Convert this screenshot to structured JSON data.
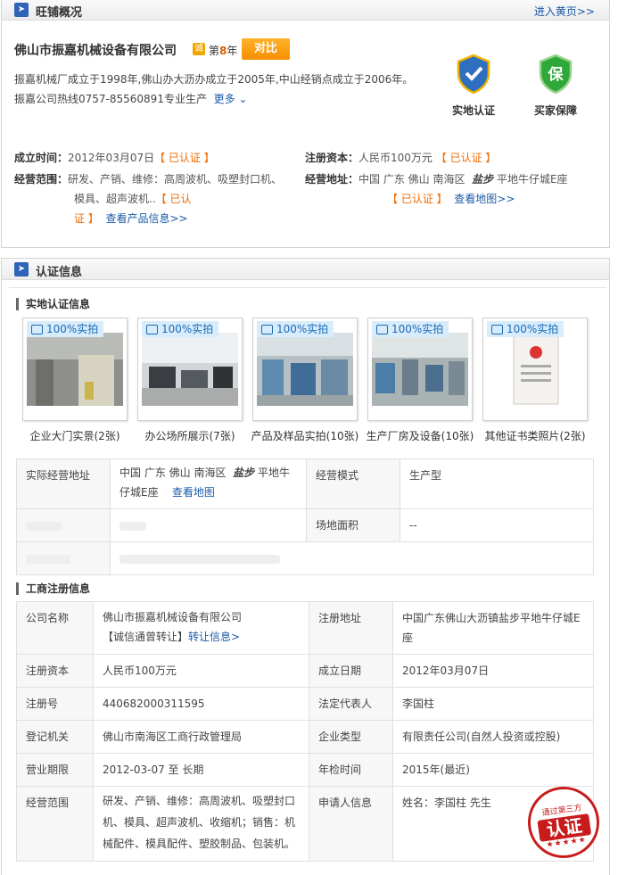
{
  "overview": {
    "title": "旺铺概况",
    "enter_shop_link": "进入黄页>>",
    "company_name": "佛山市振嘉机械设备有限公司",
    "cheng_badge": "诚",
    "years_prefix": "第",
    "years": "8",
    "years_suffix": "年",
    "compare_button": "对比",
    "intro_line1": "振嘉机械厂成立于1998年,佛山办大沥办成立于2005年,中山经销点成立于2006年。",
    "intro_line2": "振嘉公司热线0757-85560891专业生产",
    "more_link": "更多",
    "badge_onsite": "实地认证",
    "badge_buyer": "买家保障",
    "founded_label": "成立时间：",
    "founded_value": "2012年03月07日",
    "verified": "【 已认证 】",
    "capital_label": "注册资本：",
    "capital_value": "人民币100万元",
    "scope_label": "经营范围：",
    "scope_line1": "研发、产销、维修：高周波机、吸塑封口机、",
    "scope_line2": "模具、超声波机..",
    "scope_verified_a": "【 已认",
    "scope_verified_b": "证 】",
    "view_products_link": "查看产品信息>>",
    "address_label": "经营地址：",
    "address_value_a": "中国  广东  佛山  南海区",
    "address_value_b": "盐步",
    "address_value_c": "平地牛仔城E座",
    "address_verified": "【 已认证 】",
    "view_map_link": "查看地图>>"
  },
  "cert": {
    "title": "认证信息",
    "onsite_section": "实地认证信息",
    "photo_tag": "100%实拍",
    "photos": [
      {
        "caption": "企业大门实景(2张)"
      },
      {
        "caption": "办公场所展示(7张)"
      },
      {
        "caption": "产品及样品实拍(10张)"
      },
      {
        "caption": "生产厂房及设备(10张)"
      },
      {
        "caption": "其他证书类照片(2张)"
      }
    ],
    "site_table": {
      "addr_label": "实际经营地址",
      "addr_value_a": "中国  广东  佛山  南海区",
      "addr_value_b": "盐步",
      "addr_value_c": "平地牛",
      "addr_value_d": "仔城E座",
      "view_map": "查看地图",
      "mode_label": "经营模式",
      "mode_value": "生产型",
      "area_label": "场地面积",
      "area_value": "--"
    },
    "biz_section": "工商注册信息",
    "biz": {
      "name_label": "公司名称",
      "name_value": "佛山市振嘉机械设备有限公司",
      "trust_note": "【诚信通曾转让】",
      "transfer_link": "转让信息>",
      "reg_addr_label": "注册地址",
      "reg_addr_value": "中国广东佛山大沥镇盐步平地牛仔城E座",
      "capital_label": "注册资本",
      "capital_value": "人民币100万元",
      "date_label": "成立日期",
      "date_value": "2012年03月07日",
      "reg_no_label": "注册号",
      "reg_no_value": "440682000311595",
      "rep_label": "法定代表人",
      "rep_value": "李国柱",
      "authority_label": "登记机关",
      "authority_value": "佛山市南海区工商行政管理局",
      "type_label": "企业类型",
      "type_value": "有限责任公司(自然人投资或控股)",
      "term_label": "营业期限",
      "term_value": "2012-03-07  至  长期",
      "inspect_label": "年检时间",
      "inspect_value": "2015年(最近)",
      "scope_label": "经营范围",
      "scope_line1": "研发、产销、维修：高周波机、吸塑封口",
      "scope_line2": "机、模具、超声波机、收缩机；销售：机",
      "scope_line3": "械配件、模具配件、塑胶制品、包装机。",
      "applicant_label": "申请人信息",
      "applicant_value": "姓名：李国柱  先生"
    },
    "stamp_top": "通过第三方",
    "stamp_main": "认证",
    "stamp_stars": "★★★★★"
  }
}
